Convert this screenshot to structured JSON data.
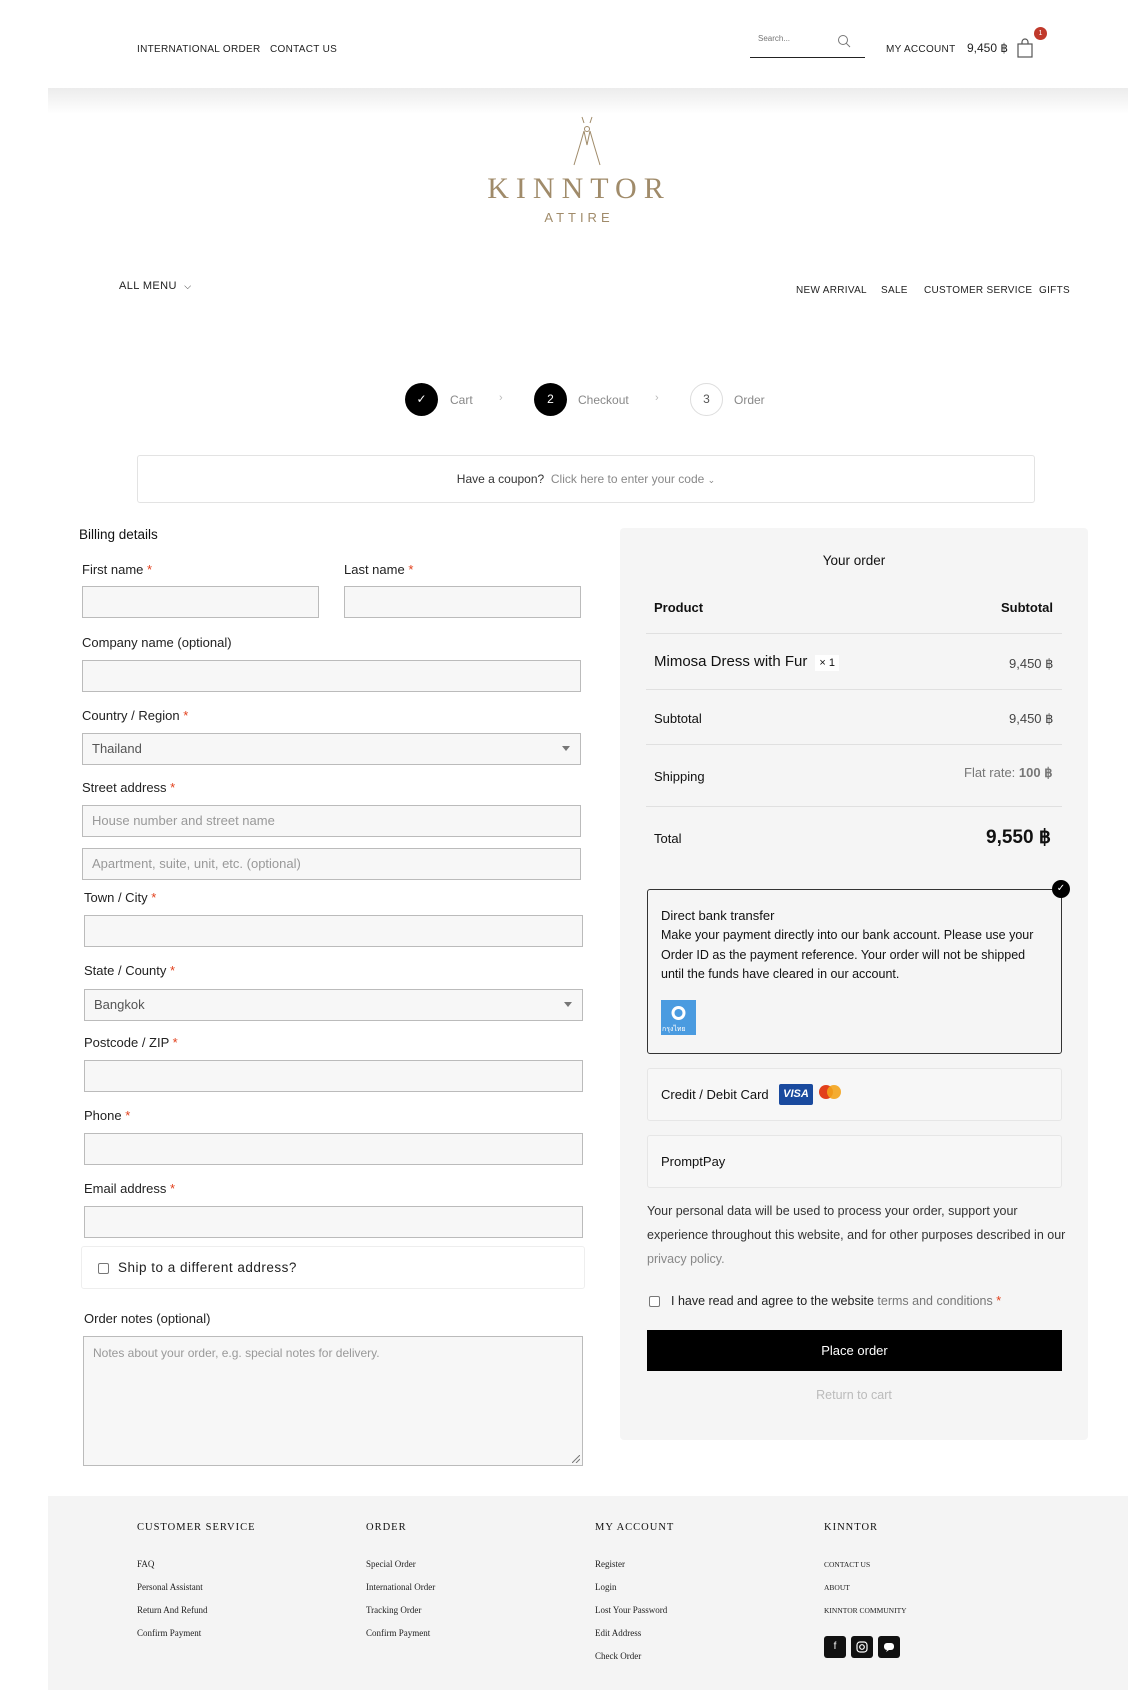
{
  "header": {
    "links": [
      "INTERNATIONAL ORDER",
      "CONTACT US"
    ],
    "search_placeholder": "Search...",
    "my_account": "MY ACCOUNT",
    "cart_total": "9,450 ฿",
    "cart_count": "1"
  },
  "logo": {
    "name": "KINNTOR",
    "sub": "ATTIRE"
  },
  "nav": {
    "all_menu": "ALL MENU",
    "links": [
      "NEW ARRIVAL",
      "SALE",
      "CUSTOMER SERVICE",
      "GIFTS"
    ]
  },
  "steps": [
    {
      "num": "✓",
      "label": "Cart"
    },
    {
      "num": "2",
      "label": "Checkout"
    },
    {
      "num": "3",
      "label": "Order"
    }
  ],
  "coupon": {
    "text": "Have a coupon?",
    "link": "Click here to enter your code"
  },
  "billing": {
    "title": "Billing details",
    "first_name": "First name",
    "last_name": "Last name",
    "company": "Company name (optional)",
    "country": "Country / Region",
    "country_value": "Thailand",
    "street": "Street address",
    "street_ph1": "House number and street name",
    "street_ph2": "Apartment, suite, unit, etc. (optional)",
    "city": "Town / City",
    "state": "State / County",
    "state_value": "Bangkok",
    "postcode": "Postcode / ZIP",
    "phone": "Phone",
    "email": "Email address",
    "required_mark": "*",
    "ship_different": "Ship to a different address?",
    "notes_label": "Order notes (optional)",
    "notes_ph": "Notes about your order, e.g. special notes for delivery."
  },
  "order": {
    "title": "Your order",
    "col_product": "Product",
    "col_subtotal": "Subtotal",
    "item_name": "Mimosa Dress with Fur",
    "item_qty": "× 1",
    "item_price": "9,450 ฿",
    "subtotal_label": "Subtotal",
    "subtotal_value": "9,450 ฿",
    "shipping_label": "Shipping",
    "shipping_prefix": "Flat rate:",
    "shipping_value": "100 ฿",
    "total_label": "Total",
    "total_value": "9,550 ฿"
  },
  "payment": {
    "bank_title": "Direct bank transfer",
    "bank_desc": "Make your payment directly into our bank account. Please use your Order ID as the payment reference. Your order will not be shipped until the funds have cleared in our account.",
    "bank_icon_text": "กรุงไทย",
    "card_title": "Credit / Debit Card",
    "visa": "VISA",
    "promptpay": "PromptPay"
  },
  "privacy": {
    "text": "Your personal data will be used to process your order, support your experience throughout this website, and for other purposes described in our",
    "link": "privacy policy."
  },
  "terms": {
    "text": "I have read and agree to the website",
    "link": "terms and conditions"
  },
  "place_order": "Place order",
  "return_to_cart": "Return to cart",
  "footer": {
    "columns": [
      {
        "title": "CUSTOMER SERVICE",
        "items": [
          "FAQ",
          "Personal Assistant",
          "Return And Refund",
          "Confirm Payment"
        ]
      },
      {
        "title": "ORDER",
        "items": [
          "Special Order",
          "International Order",
          "Tracking Order",
          "Confirm Payment"
        ]
      },
      {
        "title": "MY ACCOUNT",
        "items": [
          "Register",
          "Login",
          "Lost Your Password",
          "Edit Address",
          "Check Order"
        ]
      },
      {
        "title": "KINNTOR",
        "items": [
          "CONTACT US",
          "ABOUT",
          "KINNTOR COMMUNITY"
        ]
      }
    ],
    "social": [
      "facebook-icon",
      "instagram-icon",
      "line-icon"
    ]
  }
}
